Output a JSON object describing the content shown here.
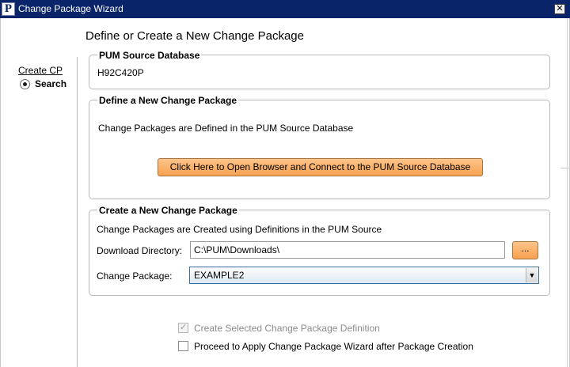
{
  "window": {
    "app_icon_letter": "P",
    "title": "Change Package Wizard",
    "close_glyph": "✕"
  },
  "heading": "Define or Create a New Change Package",
  "nav": {
    "create_label": "Create CP",
    "search_label": "Search",
    "search_selected": true
  },
  "source_group": {
    "title": "PUM Source Database",
    "value": "H92C420P"
  },
  "define_group": {
    "title": "Define a New Change Package",
    "description": "Change Packages are Defined in the PUM Source Database",
    "button_label": "Click Here to Open Browser and Connect to the PUM Source Database"
  },
  "create_group": {
    "title": "Create a New Change Package",
    "description": "Change Packages are Created using Definitions in the PUM Source",
    "download_label": "Download Directory:",
    "download_value": "C:\\PUM\\Downloads\\",
    "browse_label": "...",
    "package_label": "Change Package:",
    "package_value": "EXAMPLE2",
    "dropdown_glyph": "▼"
  },
  "options": {
    "create_definition_label": "Create Selected Change Package Definition",
    "create_definition_checked": true,
    "create_definition_enabled": false,
    "proceed_label": "Proceed to Apply Change Package Wizard after Package Creation",
    "proceed_checked": false
  },
  "colors": {
    "titlebar": "#0a246a",
    "button_orange": "#f6a150",
    "group_border": "#b9b9b9"
  },
  "icons": {
    "app": "peoplesoft-p-icon",
    "close": "close-icon",
    "dropdown": "chevron-down-icon"
  }
}
